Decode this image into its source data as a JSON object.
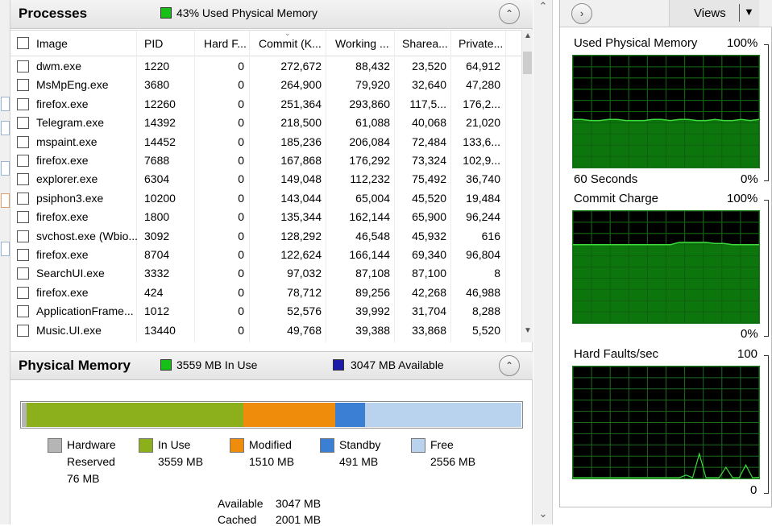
{
  "processes": {
    "title": "Processes",
    "memory_used_text": "43% Used Physical Memory",
    "columns": [
      "Image",
      "PID",
      "Hard F...",
      "Commit (K...",
      "Working ...",
      "Sharea...",
      "Private..."
    ],
    "rows": [
      [
        "dwm.exe",
        "1220",
        "0",
        "272,672",
        "88,432",
        "23,520",
        "64,912"
      ],
      [
        "MsMpEng.exe",
        "3680",
        "0",
        "264,900",
        "79,920",
        "32,640",
        "47,280"
      ],
      [
        "firefox.exe",
        "12260",
        "0",
        "251,364",
        "293,860",
        "117,5...",
        "176,2..."
      ],
      [
        "Telegram.exe",
        "14392",
        "0",
        "218,500",
        "61,088",
        "40,068",
        "21,020"
      ],
      [
        "mspaint.exe",
        "14452",
        "0",
        "185,236",
        "206,084",
        "72,484",
        "133,6..."
      ],
      [
        "firefox.exe",
        "7688",
        "0",
        "167,868",
        "176,292",
        "73,324",
        "102,9..."
      ],
      [
        "explorer.exe",
        "6304",
        "0",
        "149,048",
        "112,232",
        "75,492",
        "36,740"
      ],
      [
        "psiphon3.exe",
        "10200",
        "0",
        "143,044",
        "65,004",
        "45,520",
        "19,484"
      ],
      [
        "firefox.exe",
        "1800",
        "0",
        "135,344",
        "162,144",
        "65,900",
        "96,244"
      ],
      [
        "svchost.exe (Wbio...",
        "3092",
        "0",
        "128,292",
        "46,548",
        "45,932",
        "616"
      ],
      [
        "firefox.exe",
        "8704",
        "0",
        "122,624",
        "166,144",
        "69,340",
        "96,804"
      ],
      [
        "SearchUI.exe",
        "3332",
        "0",
        "97,032",
        "87,108",
        "87,100",
        "8"
      ],
      [
        "firefox.exe",
        "424",
        "0",
        "78,712",
        "89,256",
        "42,268",
        "46,988"
      ],
      [
        "ApplicationFrame...",
        "1012",
        "0",
        "52,576",
        "39,992",
        "31,704",
        "8,288"
      ],
      [
        "Music.UI.exe",
        "13440",
        "0",
        "49,768",
        "39,388",
        "33,868",
        "5,520"
      ]
    ]
  },
  "physical_memory": {
    "title": "Physical Memory",
    "in_use_text": "3559 MB In Use",
    "available_text": "3047 MB Available",
    "bar": [
      {
        "name": "Hardware Reserved",
        "mb": 76,
        "color": "#b5b5b5"
      },
      {
        "name": "In Use",
        "mb": 3559,
        "color": "#8cb01c"
      },
      {
        "name": "Modified",
        "mb": 1510,
        "color": "#f08c0c"
      },
      {
        "name": "Standby",
        "mb": 491,
        "color": "#3b7fd4"
      },
      {
        "name": "Free",
        "mb": 2556,
        "color": "#b9d3ef"
      }
    ],
    "legend": [
      {
        "line1": "Hardware",
        "line2": "Reserved",
        "line3": "76 MB",
        "color": "#b5b5b5"
      },
      {
        "line1": "In Use",
        "line2": "3559 MB",
        "line3": "",
        "color": "#8cb01c"
      },
      {
        "line1": "Modified",
        "line2": "1510 MB",
        "line3": "",
        "color": "#f08c0c"
      },
      {
        "line1": "Standby",
        "line2": "491 MB",
        "line3": "",
        "color": "#3b7fd4"
      },
      {
        "line1": "Free",
        "line2": "2556 MB",
        "line3": "",
        "color": "#b9d3ef"
      }
    ],
    "summary": [
      {
        "label": "Available",
        "value": "3047 MB"
      },
      {
        "label": "Cached",
        "value": "2001 MB"
      }
    ]
  },
  "right_panel": {
    "views_label": "Views",
    "graphs": [
      {
        "title": "Used Physical Memory",
        "max_label": "100%",
        "left_bottom": "60 Seconds",
        "right_bottom": "0%",
        "series": [
          0.43,
          0.43,
          0.42,
          0.42,
          0.43,
          0.43,
          0.42,
          0.42,
          0.42,
          0.43,
          0.43,
          0.42,
          0.43,
          0.43,
          0.42,
          0.42,
          0.43,
          0.42,
          0.42,
          0.43,
          0.42,
          0.43
        ]
      },
      {
        "title": "Commit Charge",
        "max_label": "100%",
        "left_bottom": "",
        "right_bottom": "0%",
        "series": [
          0.7,
          0.7,
          0.7,
          0.7,
          0.7,
          0.7,
          0.7,
          0.7,
          0.7,
          0.7,
          0.7,
          0.7,
          0.72,
          0.72,
          0.72,
          0.72,
          0.71,
          0.71,
          0.7,
          0.7,
          0.7,
          0.7
        ]
      },
      {
        "title": "Hard Faults/sec",
        "max_label": "100",
        "left_bottom": "",
        "right_bottom": "0",
        "series": [
          0,
          0,
          0,
          0,
          0,
          0,
          0,
          0,
          0,
          0,
          0,
          0,
          0,
          0,
          0,
          0,
          0,
          0.03,
          0,
          0.22,
          0,
          0,
          0,
          0.1,
          0,
          0,
          0.12,
          0,
          0.01
        ]
      }
    ]
  },
  "colors": {
    "graph_line": "#3cdc3c",
    "graph_fill": "#0e8a0e",
    "graph_grid": "#1f6a1f",
    "in_use_swatch": "#16c016",
    "available_swatch": "#1c1ca8"
  }
}
